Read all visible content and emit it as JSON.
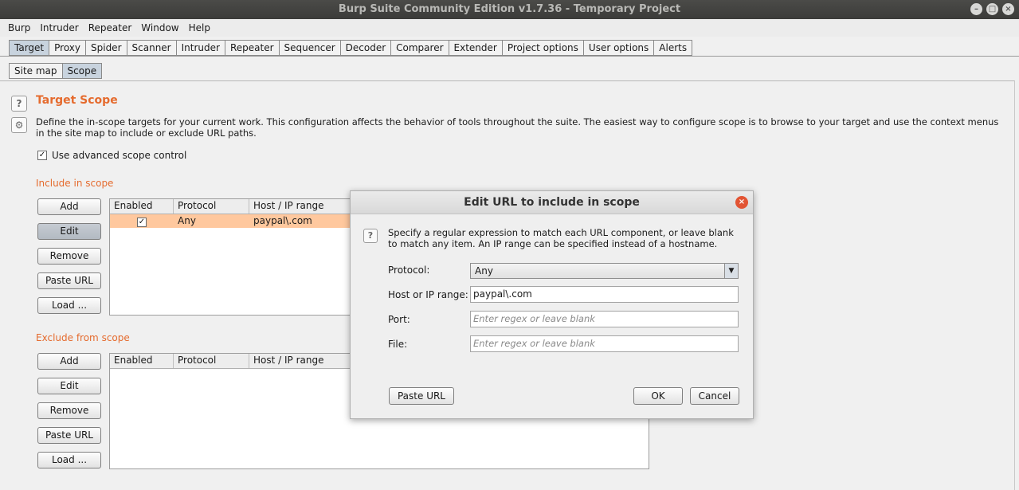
{
  "window": {
    "title": "Burp Suite Community Edition v1.7.36 - Temporary Project",
    "controls": [
      "minimize-icon",
      "maximize-icon",
      "close-icon"
    ]
  },
  "menu": [
    "Burp",
    "Intruder",
    "Repeater",
    "Window",
    "Help"
  ],
  "main_tabs": {
    "items": [
      "Target",
      "Proxy",
      "Spider",
      "Scanner",
      "Intruder",
      "Repeater",
      "Sequencer",
      "Decoder",
      "Comparer",
      "Extender",
      "Project options",
      "User options",
      "Alerts"
    ],
    "active": "Target"
  },
  "sub_tabs": {
    "items": [
      "Site map",
      "Scope"
    ],
    "active": "Scope"
  },
  "scope": {
    "title": "Target Scope",
    "help_icon": "question-icon",
    "settings_icon": "gear-icon",
    "description": "Define the in-scope targets for your current work. This configuration affects the behavior of tools throughout the suite. The easiest way to configure scope is to browse to your target and use the context menus in the site map to include or exclude URL paths.",
    "advanced_label": "Use advanced scope control",
    "advanced_checked": true,
    "include": {
      "label": "Include in scope",
      "buttons": [
        "Add",
        "Edit",
        "Remove",
        "Paste URL",
        "Load ..."
      ],
      "columns": [
        "Enabled",
        "Protocol",
        "Host / IP range"
      ],
      "rows": [
        {
          "enabled": "✓",
          "protocol": "Any",
          "host": "paypal\\.com"
        }
      ]
    },
    "exclude": {
      "label": "Exclude from scope",
      "buttons": [
        "Add",
        "Edit",
        "Remove",
        "Paste URL",
        "Load ..."
      ],
      "columns": [
        "Enabled",
        "Protocol",
        "Host / IP range"
      ],
      "rows": []
    }
  },
  "dialog": {
    "title": "Edit URL to include in scope",
    "help_text": "Specify a regular expression to match each URL component, or leave blank to match any item. An IP range can be specified instead of a hostname.",
    "protocol_label": "Protocol:",
    "protocol_value": "Any",
    "host_label": "Host or IP range:",
    "host_value": "paypal\\.com",
    "port_label": "Port:",
    "port_placeholder": "Enter regex or leave blank",
    "file_label": "File:",
    "file_placeholder": "Enter regex or leave blank",
    "paste_url": "Paste URL",
    "ok": "OK",
    "cancel": "Cancel"
  },
  "colors": {
    "accent": "#e56b2e",
    "selected_row": "#ffc89e",
    "active_tab": "#c8d3de",
    "close_button": "#e25433"
  }
}
